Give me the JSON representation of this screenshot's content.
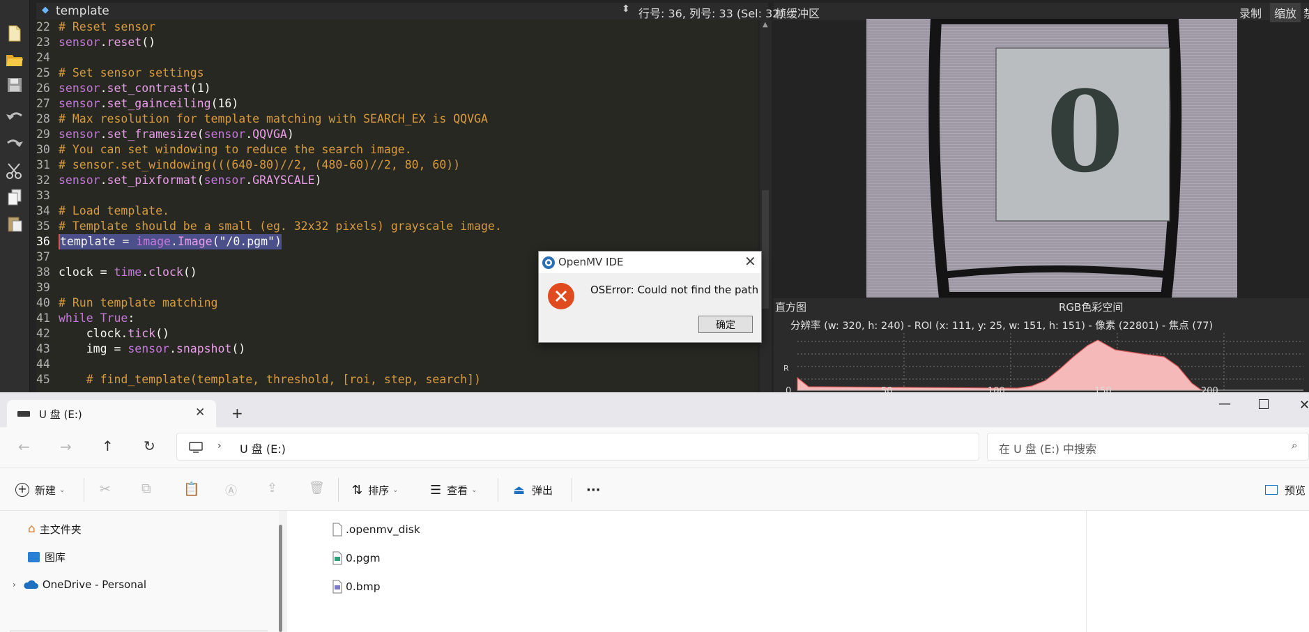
{
  "ide": {
    "editor_tab_title": "template",
    "status": "行号: 36, 列号: 33 (Sel: 32)",
    "framebuffer_label": "帧缓冲区",
    "record_label": "录制",
    "zoom_label": "缩放",
    "extra_label": "禁",
    "histogram_label": "直方图",
    "colorspace_label": "RGB色彩空间",
    "hist_info": "分辨率  (w: 320,  h: 240)  - ROI  (x: 111,  y: 25,  w: 151,  h: 151)  - 像素  (22801)  - 焦点  (77)",
    "hist_axis_ticks": [
      "0",
      "50",
      "100",
      "150",
      "200"
    ],
    "hist_channel_label": "R",
    "frame_digit": "0",
    "code_lines": [
      {
        "n": "22",
        "t": "# Reset sensor"
      },
      {
        "n": "23",
        "t": "sensor.reset()"
      },
      {
        "n": "24",
        "t": ""
      },
      {
        "n": "25",
        "t": "# Set sensor settings"
      },
      {
        "n": "26",
        "t": "sensor.set_contrast(1)"
      },
      {
        "n": "27",
        "t": "sensor.set_gainceiling(16)"
      },
      {
        "n": "28",
        "t": "# Max resolution for template matching with SEARCH_EX is QQVGA"
      },
      {
        "n": "29",
        "t": "sensor.set_framesize(sensor.QQVGA)"
      },
      {
        "n": "30",
        "t": "# You can set windowing to reduce the search image."
      },
      {
        "n": "31",
        "t": "# sensor.set_windowing(((640-80)//2, (480-60)//2, 80, 60))"
      },
      {
        "n": "32",
        "t": "sensor.set_pixformat(sensor.GRAYSCALE)"
      },
      {
        "n": "33",
        "t": ""
      },
      {
        "n": "34",
        "t": "# Load template."
      },
      {
        "n": "35",
        "t": "# Template should be a small (eg. 32x32 pixels) grayscale image."
      },
      {
        "n": "36",
        "t": "template = image.Image(\"/0.pgm\")"
      },
      {
        "n": "37",
        "t": ""
      },
      {
        "n": "38",
        "t": "clock = time.clock()"
      },
      {
        "n": "39",
        "t": ""
      },
      {
        "n": "40",
        "t": "# Run template matching"
      },
      {
        "n": "41",
        "t": "while True:"
      },
      {
        "n": "42",
        "t": "    clock.tick()"
      },
      {
        "n": "43",
        "t": "    img = sensor.snapshot()"
      },
      {
        "n": "44",
        "t": ""
      },
      {
        "n": "45",
        "t": "    # find_template(template, threshold, [roi, step, search])"
      }
    ]
  },
  "dialog": {
    "title": "OpenMV IDE",
    "message": "OSError: Could not find the path",
    "ok_label": "确定"
  },
  "explorer": {
    "tab_title": "U 盘 (E:)",
    "address": "U 盘 (E:)",
    "search_placeholder": "在 U 盘 (E:) 中搜索",
    "commands": {
      "new": "新建",
      "sort": "排序",
      "view": "查看",
      "eject": "弹出",
      "more": "···",
      "preview": "预览"
    },
    "nav_items": [
      {
        "label": "主文件夹",
        "icon": "home-icon"
      },
      {
        "label": "图库",
        "icon": "gallery-icon"
      },
      {
        "label": "OneDrive - Personal",
        "icon": "cloud-icon"
      }
    ],
    "files": [
      {
        "name": ".openmv_disk",
        "icon": "file-icon"
      },
      {
        "name": "0.pgm",
        "icon": "image-file-icon"
      },
      {
        "name": "0.bmp",
        "icon": "image-file-icon"
      }
    ]
  },
  "colors": {
    "editor_bg": "#272822",
    "selection": "#4b4f8a",
    "comment": "#d79a3e",
    "dialog_error": "#e04a1f",
    "hist_fill": "#f4b8b8"
  }
}
